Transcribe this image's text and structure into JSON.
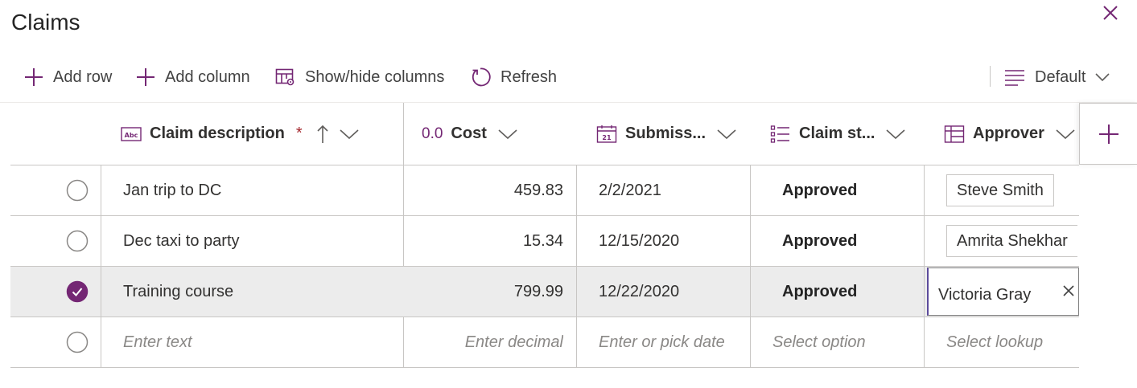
{
  "panel": {
    "title": "Claims",
    "close_icon": "close-icon"
  },
  "toolbar": {
    "add_row": "Add row",
    "add_column": "Add column",
    "show_hide_columns": "Show/hide columns",
    "refresh": "Refresh",
    "view": "Default"
  },
  "columns": [
    {
      "label": "Claim description",
      "icon": "text-field-icon",
      "required": "*",
      "sort": "ascending"
    },
    {
      "label": "Cost",
      "icon_text": "0.0",
      "icon": "decimal-icon"
    },
    {
      "label": "Submiss...",
      "icon": "calendar-icon",
      "icon_text": "21"
    },
    {
      "label": "Claim st...",
      "icon": "choice-list-icon"
    },
    {
      "label": "Approver",
      "icon": "lookup-icon"
    }
  ],
  "rows": [
    {
      "selected": false,
      "description": "Jan trip to DC",
      "cost": "459.83",
      "submitted": "2/2/2021",
      "status": "Approved",
      "approver": "Steve Smith"
    },
    {
      "selected": false,
      "description": "Dec taxi to party",
      "cost": "15.34",
      "submitted": "12/15/2020",
      "status": "Approved",
      "approver": "Amrita Shekhar"
    },
    {
      "selected": true,
      "description": "Training course",
      "cost": "799.99",
      "submitted": "12/22/2020",
      "status": "Approved",
      "approver": "Victoria Gray"
    }
  ],
  "new_row": {
    "description_placeholder": "Enter text",
    "cost_placeholder": "Enter decimal",
    "date_placeholder": "Enter or pick date",
    "status_placeholder": "Select option",
    "approver_placeholder": "Select lookup"
  },
  "colors": {
    "accent": "#742774",
    "selected_row": "#ececec",
    "border": "#c8c6c4"
  }
}
